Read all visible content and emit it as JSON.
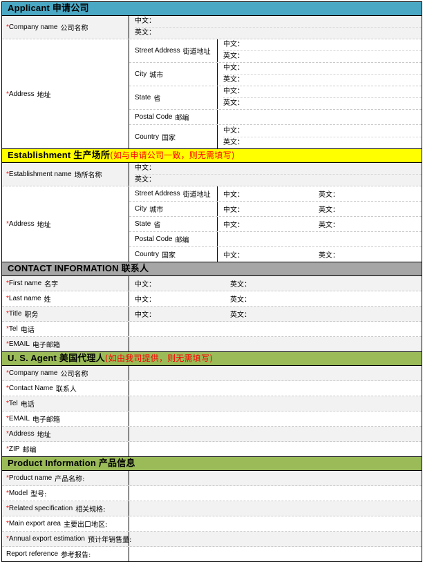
{
  "labels": {
    "cn": "中文：",
    "en": "英文："
  },
  "sections": [
    {
      "id": "applicant",
      "banner": {
        "en": "Applicant ",
        "cn": "申请公司",
        "note": "",
        "color": "#4aa8c4"
      },
      "rows": [
        {
          "label_en": "*Company name ",
          "label_cn": "公司名称",
          "type": "stacked"
        }
      ],
      "address": {
        "label_en": "*Address ",
        "label_cn": "地址",
        "sub": [
          {
            "en": "Street Address ",
            "cn": "街道地址",
            "type": "stacked"
          },
          {
            "en": "City ",
            "cn": "城市",
            "type": "stacked"
          },
          {
            "en": "State ",
            "cn": "省",
            "type": "stacked"
          },
          {
            "en": "Postal Code ",
            "cn": "邮编",
            "type": "empty"
          },
          {
            "en": "Country ",
            "cn": "国家",
            "type": "stacked"
          }
        ]
      }
    },
    {
      "id": "establishment",
      "banner": {
        "en": "Establishment ",
        "cn": "生产场所",
        "note": "(如与申请公司一致，则无需填写)",
        "color": "#ffff00"
      },
      "rows": [
        {
          "label_en": "*Establishment name ",
          "label_cn": "场所名称",
          "type": "stacked"
        }
      ],
      "address": {
        "label_en": "*Address ",
        "label_cn": "地址",
        "sub": [
          {
            "en": "Street Address ",
            "cn": "街道地址",
            "type": "inline"
          },
          {
            "en": "City ",
            "cn": "城市",
            "type": "inline"
          },
          {
            "en": "State ",
            "cn": "省",
            "type": "inline"
          },
          {
            "en": "Postal Code ",
            "cn": "邮编",
            "type": "empty"
          },
          {
            "en": "Country ",
            "cn": "国家",
            "type": "inline"
          }
        ]
      }
    },
    {
      "id": "contact",
      "banner": {
        "en": "CONTACT INFORMATION ",
        "cn": "联系人",
        "note": "",
        "color": "#a6a6a6"
      },
      "rows": [
        {
          "label_en": "*First name ",
          "label_cn": "名字",
          "type": "inline"
        },
        {
          "label_en": "*Last name ",
          "label_cn": "姓",
          "type": "inline"
        },
        {
          "label_en": "*Title ",
          "label_cn": "职务",
          "type": "inline"
        },
        {
          "label_en": "*Tel ",
          "label_cn": "电话",
          "type": "empty"
        },
        {
          "label_en": "*EMAIL ",
          "label_cn": "电子邮箱",
          "type": "empty"
        }
      ]
    },
    {
      "id": "us-agent",
      "banner": {
        "en": "U. S. Agent ",
        "cn": "美国代理人",
        "note": "(如由我司提供，则无需填写)",
        "color": "#9bbb59"
      },
      "rows": [
        {
          "label_en": "*Company name ",
          "label_cn": "公司名称",
          "type": "empty"
        },
        {
          "label_en": "*Contact Name ",
          "label_cn": "联系人",
          "type": "empty"
        },
        {
          "label_en": "*Tel ",
          "label_cn": "电话",
          "type": "empty"
        },
        {
          "label_en": "*EMAIL ",
          "label_cn": "电子邮箱",
          "type": "empty"
        },
        {
          "label_en": "*Address ",
          "label_cn": "地址",
          "type": "empty"
        },
        {
          "label_en": "*ZIP ",
          "label_cn": "邮编",
          "type": "empty"
        }
      ]
    },
    {
      "id": "product",
      "banner": {
        "en": "Product Information  ",
        "cn": "产品信息",
        "note": "",
        "color": "#9bbb59"
      },
      "rows": [
        {
          "label_en": "*Product name ",
          "label_cn": "产品名称:",
          "type": "empty"
        },
        {
          "label_en": "*Model ",
          "label_cn": "型号:",
          "type": "empty"
        },
        {
          "label_en": "*Related specification ",
          "label_cn": "相关规格:",
          "type": "empty"
        },
        {
          "label_en": "*Main export area ",
          "label_cn": "主要出口地区:",
          "type": "empty"
        },
        {
          "label_en": "*Annual export estimation ",
          "label_cn": "预计年销售量:",
          "type": "empty"
        },
        {
          "label_en": " Report reference ",
          "label_cn": "参考报告:",
          "type": "empty"
        }
      ]
    }
  ]
}
